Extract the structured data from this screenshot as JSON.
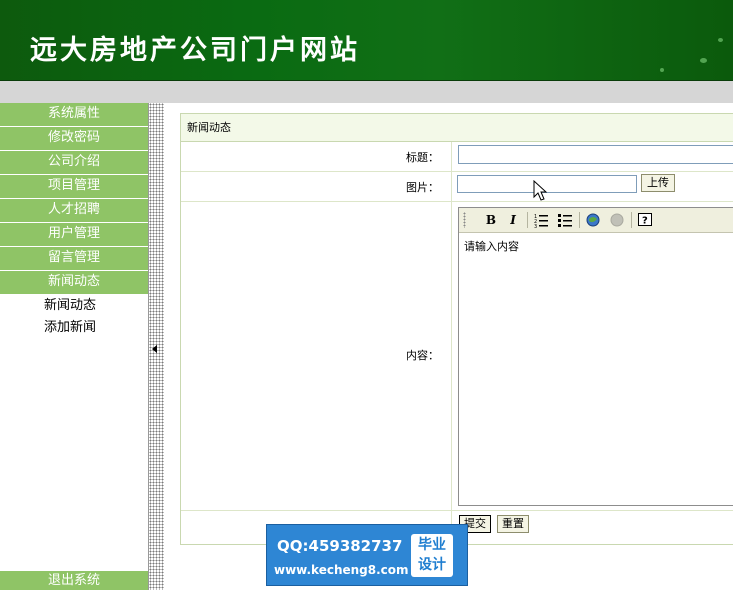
{
  "header": {
    "title": "远大房地产公司门户网站"
  },
  "sidebar": {
    "items": [
      {
        "label": "系统属性"
      },
      {
        "label": "修改密码"
      },
      {
        "label": "公司介绍"
      },
      {
        "label": "项目管理"
      },
      {
        "label": "人才招聘"
      },
      {
        "label": "用户管理"
      },
      {
        "label": "留言管理"
      },
      {
        "label": "新闻动态"
      }
    ],
    "subitems": [
      {
        "label": "新闻动态"
      },
      {
        "label": "添加新闻"
      }
    ],
    "logout_label": "退出系统"
  },
  "panel": {
    "heading": "新闻动态",
    "title_label": "标题：",
    "title_value": "",
    "image_label": "图片：",
    "image_value": "",
    "upload_label": "上传",
    "content_label": "内容：",
    "editor": {
      "bold": "B",
      "italic": "I",
      "content": "请输入内容"
    },
    "submit_label": "提交",
    "reset_label": "重置"
  },
  "watermark": {
    "qq": "QQ:459382737",
    "url": "www.kecheng8.com",
    "badge_line1": "毕业",
    "badge_line2": "设计"
  },
  "colors": {
    "header_green": "#0a6b12",
    "nav_green": "#8fc466",
    "watermark_blue": "#2e86d4"
  }
}
